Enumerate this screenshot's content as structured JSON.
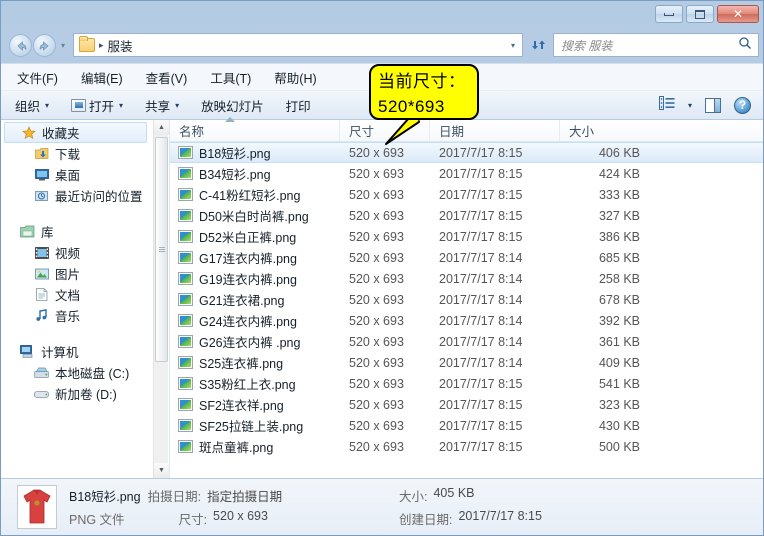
{
  "window": {
    "controls": {
      "minimize": "minimize",
      "maximize": "maximize",
      "close": "✕"
    }
  },
  "address": {
    "back_icon": "back-arrow-icon",
    "forward_icon": "forward-arrow-icon",
    "history_caret": "▾",
    "folder_icon": "folder-icon",
    "crumb_separator": "▸",
    "crumb": "服装",
    "dropdown_caret": "▾",
    "refresh_icon": "refresh-icon"
  },
  "search": {
    "placeholder": "搜索 服装",
    "value": "",
    "icon": "search-icon"
  },
  "menubar": {
    "items": [
      {
        "label": "文件(F)"
      },
      {
        "label": "编辑(E)"
      },
      {
        "label": "查看(V)"
      },
      {
        "label": "工具(T)"
      },
      {
        "label": "帮助(H)"
      }
    ]
  },
  "toolbar": {
    "organize": "组织",
    "open": "打开",
    "share": "共享",
    "slideshow": "放映幻灯片",
    "print": "打印",
    "caret": "▾",
    "view_icon": "view-list-icon",
    "view_caret": "▾",
    "preview_pane_icon": "preview-pane-icon",
    "help_icon": "help-icon",
    "help_glyph": "?"
  },
  "navpane": {
    "groups": [
      {
        "header": {
          "label": "收藏夹",
          "icon": "star-icon",
          "selected": true
        },
        "items": [
          {
            "label": "下载",
            "icon": "downloads-icon"
          },
          {
            "label": "桌面",
            "icon": "desktop-icon"
          },
          {
            "label": "最近访问的位置",
            "icon": "recent-places-icon"
          }
        ]
      },
      {
        "header": {
          "label": "库",
          "icon": "library-icon",
          "selected": false
        },
        "items": [
          {
            "label": "视频",
            "icon": "videos-icon"
          },
          {
            "label": "图片",
            "icon": "pictures-icon"
          },
          {
            "label": "文档",
            "icon": "documents-icon"
          },
          {
            "label": "音乐",
            "icon": "music-icon"
          }
        ]
      },
      {
        "header": {
          "label": "计算机",
          "icon": "computer-icon",
          "selected": false
        },
        "items": [
          {
            "label": "本地磁盘 (C:)",
            "icon": "local-disk-icon"
          },
          {
            "label": "新加卷 (D:)",
            "icon": "drive-icon"
          }
        ]
      }
    ],
    "scroll": {
      "up": "▲",
      "down": "▼"
    }
  },
  "filelist": {
    "columns": [
      {
        "key": "name",
        "label": "名称",
        "sorted": true
      },
      {
        "key": "dimensions",
        "label": "尺寸",
        "sorted": false
      },
      {
        "key": "date",
        "label": "日期",
        "sorted": false
      },
      {
        "key": "size",
        "label": "大小",
        "sorted": false
      }
    ],
    "rows": [
      {
        "icon": "png-file-icon",
        "name": "B18短衫.png",
        "dimensions": "520 x 693",
        "date": "2017/7/17 8:15",
        "size": "406 KB",
        "selected": true
      },
      {
        "icon": "png-file-icon",
        "name": "B34短衫.png",
        "dimensions": "520 x 693",
        "date": "2017/7/17 8:15",
        "size": "424 KB",
        "selected": false
      },
      {
        "icon": "png-file-icon",
        "name": "C-41粉红短衫.png",
        "dimensions": "520 x 693",
        "date": "2017/7/17 8:15",
        "size": "333 KB",
        "selected": false
      },
      {
        "icon": "png-file-icon",
        "name": "D50米白时尚裤.png",
        "dimensions": "520 x 693",
        "date": "2017/7/17 8:15",
        "size": "327 KB",
        "selected": false
      },
      {
        "icon": "png-file-icon",
        "name": "D52米白正裤.png",
        "dimensions": "520 x 693",
        "date": "2017/7/17 8:15",
        "size": "386 KB",
        "selected": false
      },
      {
        "icon": "png-file-icon",
        "name": "G17连衣内裤.png",
        "dimensions": "520 x 693",
        "date": "2017/7/17 8:14",
        "size": "685 KB",
        "selected": false
      },
      {
        "icon": "png-file-icon",
        "name": "G19连衣内裤.png",
        "dimensions": "520 x 693",
        "date": "2017/7/17 8:14",
        "size": "258 KB",
        "selected": false
      },
      {
        "icon": "png-file-icon",
        "name": "G21连衣裙.png",
        "dimensions": "520 x 693",
        "date": "2017/7/17 8:14",
        "size": "678 KB",
        "selected": false
      },
      {
        "icon": "png-file-icon",
        "name": "G24连衣内裤.png",
        "dimensions": "520 x 693",
        "date": "2017/7/17 8:14",
        "size": "392 KB",
        "selected": false
      },
      {
        "icon": "png-file-icon",
        "name": "G26连衣内裤 .png",
        "dimensions": "520 x 693",
        "date": "2017/7/17 8:14",
        "size": "361 KB",
        "selected": false
      },
      {
        "icon": "png-file-icon",
        "name": "S25连衣裤.png",
        "dimensions": "520 x 693",
        "date": "2017/7/17 8:14",
        "size": "409 KB",
        "selected": false
      },
      {
        "icon": "png-file-icon",
        "name": "S35粉红上衣.png",
        "dimensions": "520 x 693",
        "date": "2017/7/17 8:15",
        "size": "541 KB",
        "selected": false
      },
      {
        "icon": "png-file-icon",
        "name": "SF2连衣祥.png",
        "dimensions": "520 x 693",
        "date": "2017/7/17 8:15",
        "size": "323 KB",
        "selected": false
      },
      {
        "icon": "png-file-icon",
        "name": "SF25拉链上装.png",
        "dimensions": "520 x 693",
        "date": "2017/7/17 8:15",
        "size": "430 KB",
        "selected": false
      },
      {
        "icon": "png-file-icon",
        "name": "斑点童裤.png",
        "dimensions": "520 x 693",
        "date": "2017/7/17 8:15",
        "size": "500 KB",
        "selected": false
      }
    ]
  },
  "details": {
    "thumbnail_icon": "red-shirt-thumbnail",
    "filename": "B18短衫.png",
    "shoot_date_label": "拍摄日期:",
    "shoot_date_value": "指定拍摄日期",
    "filetype": "PNG 文件",
    "dimensions_label": "尺寸:",
    "dimensions_value": "520 x 693",
    "size_label": "大小:",
    "size_value": "405 KB",
    "created_label": "创建日期:",
    "created_value": "2017/7/17 8:15"
  },
  "callout": {
    "line1": "当前尺寸：",
    "line2": "520*693",
    "background": "#ffff00",
    "border": "#000000"
  }
}
